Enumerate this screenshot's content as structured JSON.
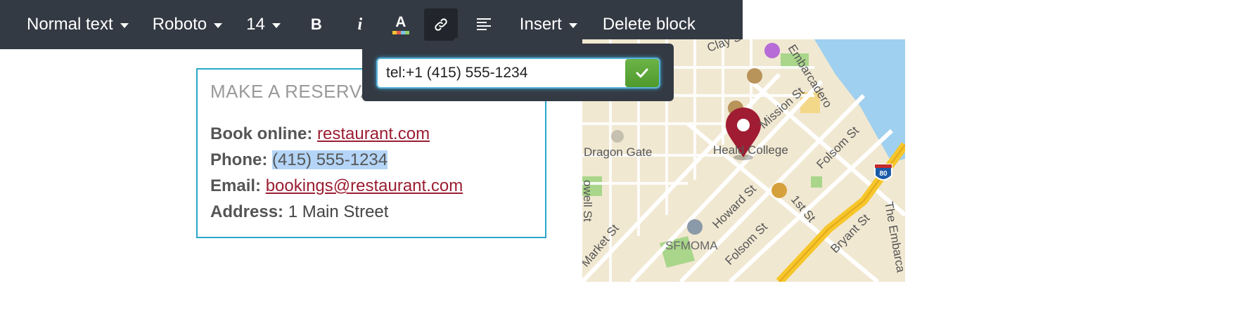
{
  "toolbar": {
    "text_style": "Normal text",
    "font_family": "Roboto",
    "font_size": "14",
    "bold": "B",
    "italic": "i",
    "color": "A",
    "insert": "Insert",
    "delete_block": "Delete block"
  },
  "link_popover": {
    "value": "tel:+1 (415) 555-1234"
  },
  "reservation": {
    "title": "MAKE A RESERVA",
    "book_label": "Book online:",
    "book_link": "restaurant.com",
    "phone_label": "Phone:",
    "phone_value": "(415) 555-1234",
    "email_label": "Email:",
    "email_link": "bookings@restaurant.com",
    "address_label": "Address:",
    "address_value": "1 Main Street"
  },
  "map": {
    "labels": {
      "clay": "Clay St",
      "embarcadero": "Embarcadero",
      "mission": "Mission St",
      "dragon_gate": "Dragon Gate",
      "heald_college": "Heald College",
      "folsom1": "Folsom St",
      "howard": "Howard St",
      "first": "1st St",
      "folsom2": "Folsom St",
      "bryant": "Bryant St",
      "the_embarca": "The Embarca",
      "market": "Market St",
      "powell": "owell St",
      "sfmoma": "SFMOMA",
      "interstate": "80"
    }
  },
  "colors": {
    "toolbar_bg": "#343a43",
    "link": "#9b1d32",
    "block_border": "#2ba6cb",
    "selection": "#b4d5f7",
    "confirm": "#5aa536",
    "pin": "#a01c32"
  }
}
